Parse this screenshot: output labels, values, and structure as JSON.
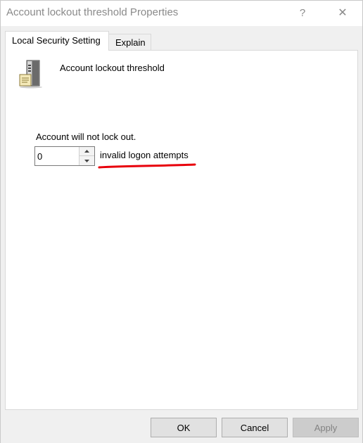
{
  "window": {
    "title": "Account lockout threshold Properties",
    "help_glyph": "?",
    "close_glyph": "✕"
  },
  "tabs": [
    {
      "label": "Local Security Setting",
      "active": true
    },
    {
      "label": "Explain",
      "active": false
    }
  ],
  "setting": {
    "icon": "server-icon",
    "policy_name": "Account lockout threshold",
    "status_text": "Account will not lock out.",
    "value": "0",
    "units_label": "invalid logon attempts",
    "annotation_color": "#e8000b"
  },
  "buttons": {
    "ok": "OK",
    "cancel": "Cancel",
    "apply": "Apply",
    "apply_enabled": false
  }
}
